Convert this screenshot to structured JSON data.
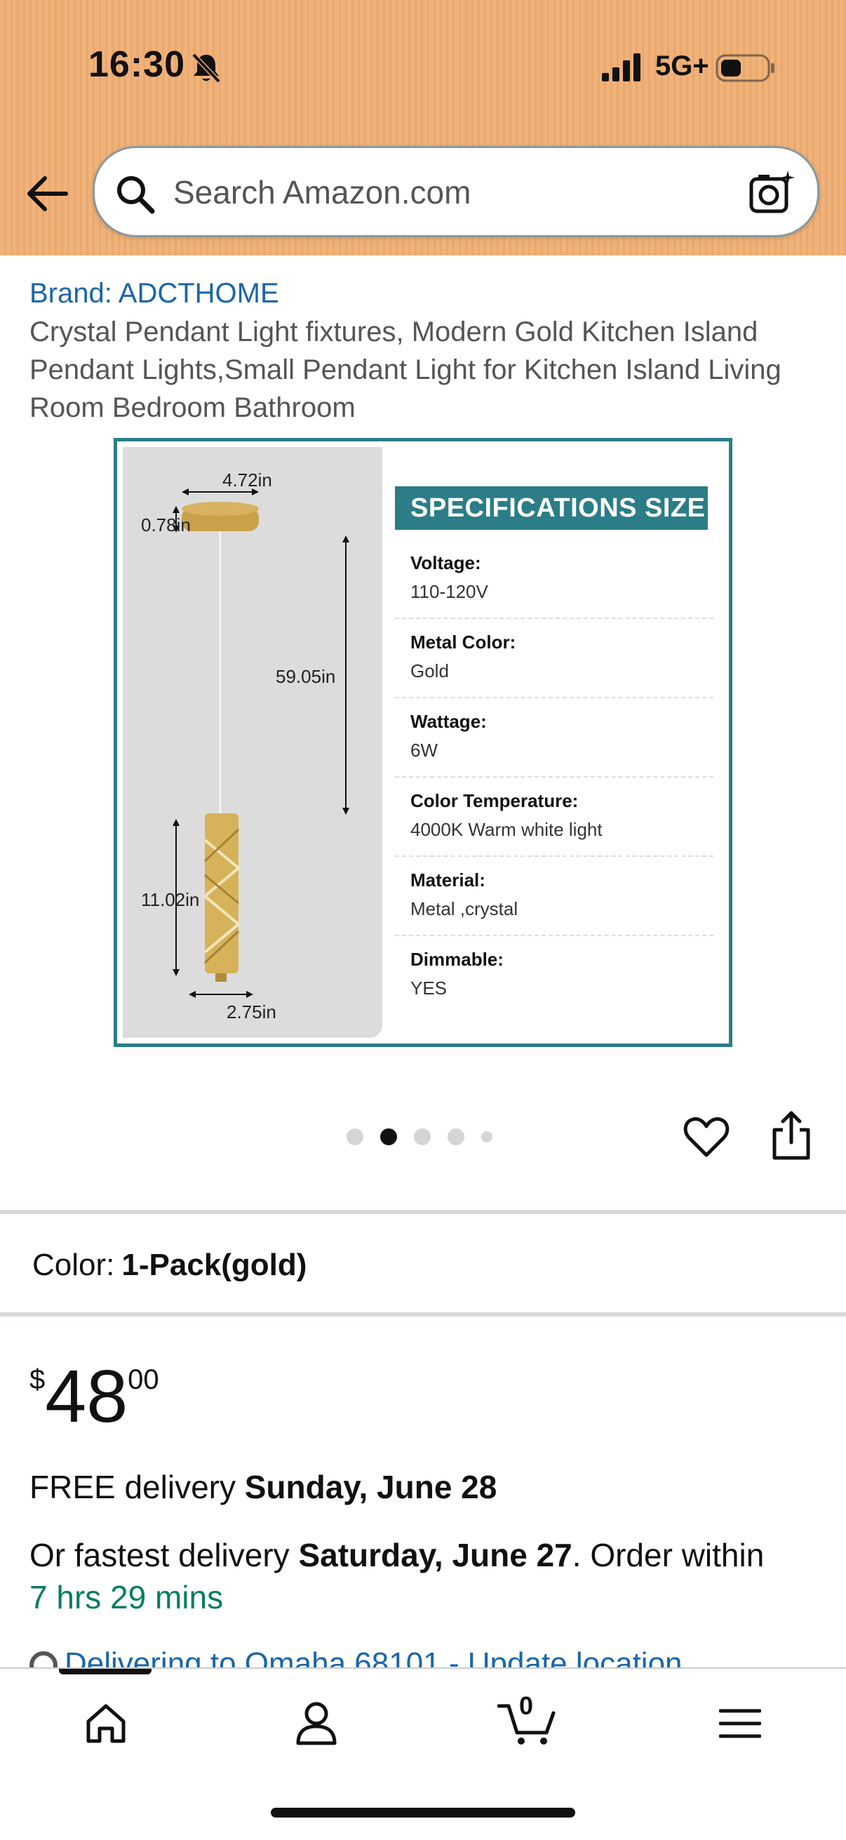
{
  "status_bar": {
    "time": "16:30",
    "network": "5G+"
  },
  "search": {
    "placeholder": "Search Amazon.com"
  },
  "product": {
    "brand": "Brand: ADCTHOME",
    "title": "Crystal Pendant Light fixtures, Modern Gold Kitchen Island Pendant Lights,Small Pendant Light for Kitchen Island Living Room Bedroom Bathroom",
    "image": {
      "dimensions": {
        "canopy_width": "4.72in",
        "canopy_height": "0.78in",
        "cord_length": "59.05in",
        "body_height": "11.02in",
        "body_width": "2.75in"
      },
      "spec_title": "SPECIFICATIONS SIZE",
      "specs": [
        {
          "label": "Voltage:",
          "value": "110-120V"
        },
        {
          "label": "Metal Color:",
          "value": "Gold"
        },
        {
          "label": "Wattage:",
          "value": "6W"
        },
        {
          "label": "Color Temperature:",
          "value": "4000K Warm white light"
        },
        {
          "label": "Material:",
          "value": "Metal ,crystal"
        },
        {
          "label": "Dimmable:",
          "value": "YES"
        }
      ]
    },
    "carousel": {
      "count": 5,
      "active_index": 1
    }
  },
  "color": {
    "label": "Color:",
    "value": "1-Pack(gold)"
  },
  "price": {
    "symbol": "$",
    "whole": "48",
    "fraction": "00"
  },
  "delivery": {
    "free_prefix": "FREE delivery ",
    "free_date": "Sunday, June 28",
    "fastest_prefix": "Or fastest delivery ",
    "fastest_date": "Saturday, June 27",
    "order_within": ". Order within ",
    "countdown": "7 hrs 29 mins",
    "location": "Delivering to Omaha 68101 - Update location"
  },
  "nav": {
    "cart_count": "0"
  },
  "colors": {
    "header": "#efb27a",
    "accent_teal": "#2b7d87",
    "link": "#1a66a8",
    "countdown": "#067d62"
  }
}
